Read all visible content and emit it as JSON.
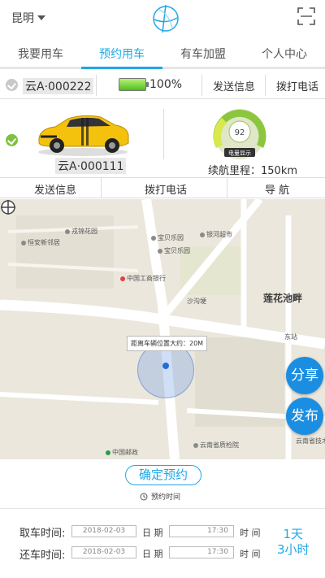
{
  "header": {
    "city": "昆明"
  },
  "tabs": [
    {
      "label": "我要用车"
    },
    {
      "label": "预约用车"
    },
    {
      "label": "有车加盟"
    },
    {
      "label": "个人中心"
    }
  ],
  "active_tab": 1,
  "car1": {
    "plate": "云A·000222",
    "battery_percent": "100%",
    "send_info": "发送信息",
    "call": "拨打电话"
  },
  "car2": {
    "plate": "云A·000111",
    "gauge_value": "92",
    "gauge_label": "电量显示",
    "range_label": "续航里程：",
    "range_value": "150km",
    "send_info": "发送信息",
    "call": "拨打电话",
    "navigate": "导  航"
  },
  "map": {
    "distance_tip": "距离车辆位置大约：20M",
    "pois": [
      "戎锦花园",
      "恒安新邻居",
      "宝贝乐园",
      "银河超市",
      "中国工商银行",
      "沙沟埂",
      "宝贝乐园",
      "东站",
      "中国邮政",
      "云南省质检院",
      "云南省技术研"
    ],
    "district": "莲花池畔",
    "share": "分享",
    "publish": "发布"
  },
  "booking": {
    "confirm": "确定预约",
    "section_label": "预约时间",
    "pickup_label": "取车时间:",
    "pickup_date": "2018-02-03",
    "pickup_time": "17:30",
    "return_label": "还车时间:",
    "return_date": "2018-02-03",
    "return_time": "17:30",
    "date_unit": "日 期",
    "time_unit": "时 间",
    "days_num": "1天",
    "hours": "3小时"
  },
  "colors": {
    "accent": "#1fa7e6",
    "fab": "#1c8ee2",
    "selected": "#7cc23c"
  }
}
